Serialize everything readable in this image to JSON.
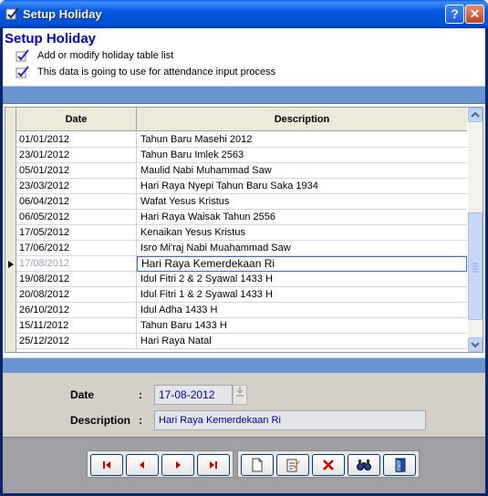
{
  "window": {
    "title": "Setup Holiday"
  },
  "header": {
    "title": "Setup Holiday",
    "notes": [
      "Add or modify holiday table list",
      "This data is going to use for attendance input process"
    ]
  },
  "grid": {
    "columns": [
      "Date",
      "Description"
    ],
    "rows": [
      {
        "date": "01/01/2012",
        "description": "Tahun Baru Masehi 2012"
      },
      {
        "date": "23/01/2012",
        "description": "Tahun Baru Imlek 2563"
      },
      {
        "date": "05/01/2012",
        "description": "Maulid Nabi Muhammad Saw"
      },
      {
        "date": "23/03/2012",
        "description": "Hari Raya Nyepi Tahun Baru Saka 1934"
      },
      {
        "date": "06/04/2012",
        "description": "Wafat Yesus Kristus"
      },
      {
        "date": "06/05/2012",
        "description": "Hari Raya Waisak Tahun 2556"
      },
      {
        "date": "17/05/2012",
        "description": "Kenaikan Yesus Kristus"
      },
      {
        "date": "17/06/2012",
        "description": "Isro Mi'raj Nabi Muahammad Saw"
      },
      {
        "date": "17/08/2012",
        "description": "Hari Raya Kemerdekaan Ri",
        "selected": true
      },
      {
        "date": "19/08/2012",
        "description": "Idul Fitri 2 & 2 Syawal 1433 H"
      },
      {
        "date": "20/08/2012",
        "description": "Idul Fitri 1 & 2 Syawal 1433 H"
      },
      {
        "date": "26/10/2012",
        "description": "Idul Adha 1433 H"
      },
      {
        "date": "15/11/2012",
        "description": "Tahun Baru 1433 H"
      },
      {
        "date": "25/12/2012",
        "description": "Hari Raya Natal"
      }
    ]
  },
  "form": {
    "date_label": "Date",
    "date_value": "17-08-2012",
    "description_label": "Description",
    "description_value": "Hari Raya Kemerdekaan Ri",
    "colon": ":"
  },
  "toolbar": {
    "navigation": [
      "first-record-icon",
      "previous-record-icon",
      "next-record-icon",
      "last-record-icon"
    ],
    "actions": [
      "new-record-icon",
      "edit-record-icon",
      "delete-record-icon",
      "find-icon",
      "exit-icon"
    ]
  },
  "colors": {
    "title_bar": "#0656e0",
    "header_title": "#0000cc",
    "band": "#6a96cf",
    "nav_arrow": "#c00000"
  }
}
